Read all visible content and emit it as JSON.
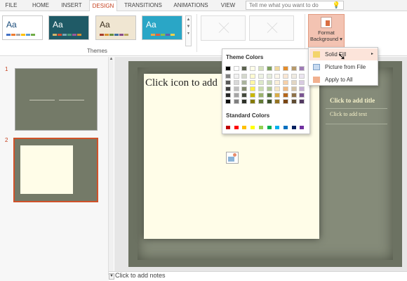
{
  "tabs": [
    "FILE",
    "HOME",
    "INSERT",
    "DESIGN",
    "TRANSITIONS",
    "ANIMATIONS",
    "VIEW"
  ],
  "active_tab": "DESIGN",
  "tell_me_placeholder": "Tell me what you want to do",
  "themes": {
    "group_label": "Themes",
    "items": [
      {
        "aa": "Aa",
        "bg": "#ffffff",
        "fg": "#1a4c7a",
        "swatches": [
          "#4472c4",
          "#ed7d31",
          "#a5a5a5",
          "#ffc000",
          "#5b9bd5",
          "#70ad47"
        ]
      },
      {
        "aa": "Aa",
        "bg": "#1f5a66",
        "fg": "#ffffff",
        "swatches": [
          "#d1b36b",
          "#d84c2f",
          "#7aa7b4",
          "#4e9e79",
          "#9b5a9a",
          "#d98f2d"
        ]
      },
      {
        "aa": "Aa",
        "bg": "#f0e6d2",
        "fg": "#3c3020",
        "swatches": [
          "#a83e2a",
          "#d68f2e",
          "#6a8f3c",
          "#3f6f9f",
          "#8a4c8a",
          "#b8a25a"
        ]
      },
      {
        "aa": "Aa",
        "bg": "#2aa6c6",
        "fg": "#ffffff",
        "swatches": [
          "#2aa6c6",
          "#f2a341",
          "#e35e3e",
          "#8ebc4b",
          "#6b5ea8",
          "#f0d04a"
        ]
      }
    ]
  },
  "format_background": {
    "label_line1": "Format",
    "label_line2": "Background",
    "caret": "▾"
  },
  "color_picker": {
    "theme_title": "Theme Colors",
    "standard_title": "Standard Colors",
    "theme_columns": [
      [
        "#000000",
        "#7f7f7f",
        "#595959",
        "#3f3f3f",
        "#262626",
        "#0c0c0c"
      ],
      [
        "#ffffff",
        "#f2f2f2",
        "#d8d8d8",
        "#bfbfbf",
        "#a5a5a5",
        "#7f7f7f"
      ],
      [
        "#5c6350",
        "#d5d9cd",
        "#abb39c",
        "#82896e",
        "#454a3c",
        "#2e3128"
      ],
      [
        "#fffde8",
        "#fffbd1",
        "#fff7a4",
        "#ffef49",
        "#c9b700",
        "#857a00"
      ],
      [
        "#d6e3bc",
        "#eef3e4",
        "#dce8c9",
        "#cadcae",
        "#9ab26c",
        "#627a36"
      ],
      [
        "#7ba05b",
        "#e4ecdb",
        "#c9d9b7",
        "#afc793",
        "#5b7a40",
        "#3c5129"
      ],
      [
        "#f0d89c",
        "#fcf7eb",
        "#f9efd7",
        "#f5e7c4",
        "#d9ac46",
        "#957321"
      ],
      [
        "#e48c2b",
        "#fae7d4",
        "#f5d0a9",
        "#f0b87f",
        "#b4661a",
        "#784411"
      ],
      [
        "#b79a6b",
        "#f0ebe1",
        "#e2d6c3",
        "#d3c2a5",
        "#8d7149",
        "#5e4b31"
      ],
      [
        "#9e7bb5",
        "#ebe4f0",
        "#d8cae1",
        "#c4afd3",
        "#7a5492",
        "#513861"
      ]
    ],
    "standard": [
      "#c00000",
      "#ff0000",
      "#ffc000",
      "#ffff00",
      "#92d050",
      "#00b050",
      "#00b0f0",
      "#0070c0",
      "#002060",
      "#7030a0"
    ]
  },
  "menu": {
    "items": [
      {
        "label": "Solid Fill",
        "arrow": "▸"
      },
      {
        "label": "Picture from File"
      },
      {
        "label": "Apply to All"
      }
    ]
  },
  "slides": {
    "numbers": [
      "1",
      "2"
    ]
  },
  "slide": {
    "left_placeholder": "Click icon to add",
    "right_title": "Click to add title",
    "right_text": "Click to add text"
  },
  "notes_placeholder": "Click to add notes"
}
